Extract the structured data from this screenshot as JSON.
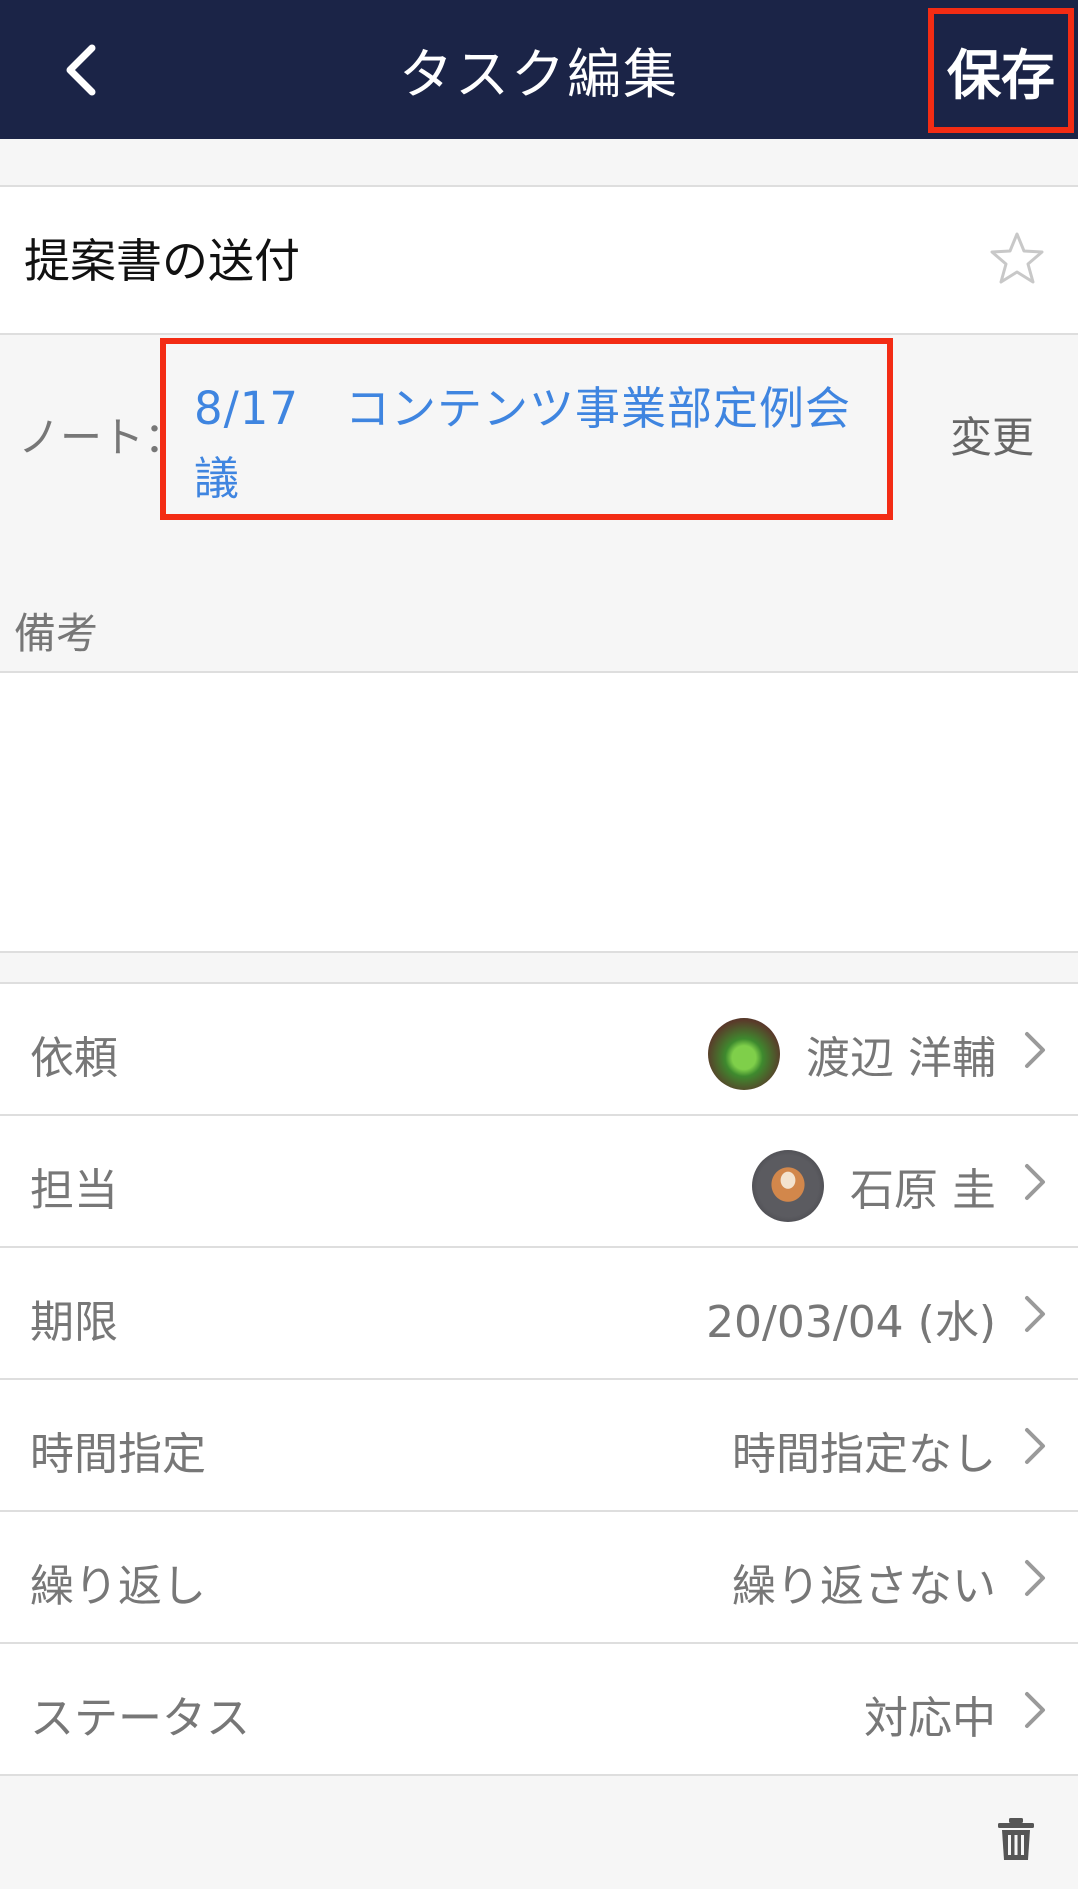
{
  "header": {
    "title": "タスク編集",
    "save_label": "保存",
    "background_color": "#1b2447",
    "highlight_color": "#f32c14"
  },
  "task": {
    "title": "提案書の送付",
    "starred": false
  },
  "note": {
    "label": "ノート：",
    "link_text": "8/17　コンテンツ事業部定例会議",
    "change_label": "変更",
    "link_color": "#3f85e0"
  },
  "memo": {
    "label": "備考",
    "value": ""
  },
  "details": [
    {
      "label": "依頼",
      "value": "渡辺 洋輔",
      "avatar": "plant-avatar"
    },
    {
      "label": "担当",
      "value": "石原 圭",
      "avatar": "dog-avatar"
    },
    {
      "label": "期限",
      "value": "20/03/04 (水)"
    },
    {
      "label": "時間指定",
      "value": "時間指定なし"
    },
    {
      "label": "繰り返し",
      "value": "繰り返さない"
    },
    {
      "label": "ステータス",
      "value": "対応中"
    }
  ],
  "icons": {
    "back": "chevron-left-icon",
    "star": "star-outline-icon",
    "row": "chevron-right-icon",
    "delete": "trash-icon"
  }
}
